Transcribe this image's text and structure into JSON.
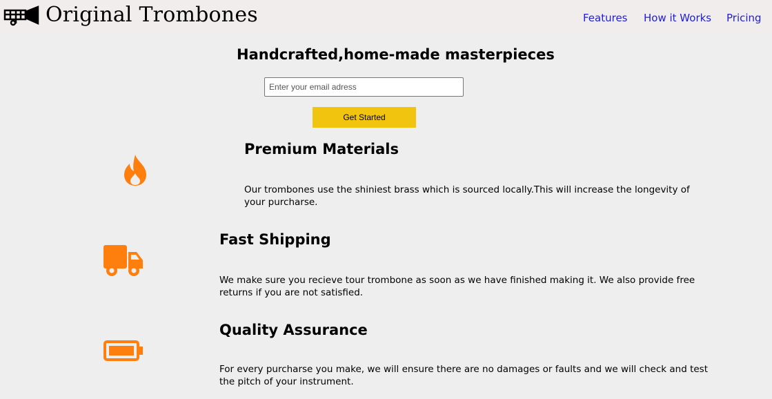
{
  "header": {
    "logo_text": "Original Trombones",
    "nav": [
      {
        "label": "Features"
      },
      {
        "label": "How it Works"
      },
      {
        "label": "Pricing"
      }
    ]
  },
  "hero": {
    "title": "Handcrafted,home-made masterpieces",
    "email_placeholder": "Enter your email adress",
    "email_value": "",
    "cta_label": "Get Started"
  },
  "features": [
    {
      "icon": "fire-icon",
      "title": "Premium Materials",
      "description": "Our trombones use the shiniest brass which is sourced locally.This will increase the longevity of your purcharse."
    },
    {
      "icon": "truck-icon",
      "title": "Fast Shipping",
      "description": "We make sure you recieve tour trombone as soon as we have finished making it. We also provide free returns if you are not satisfied."
    },
    {
      "icon": "battery-full-icon",
      "title": "Quality Assurance",
      "description": "For every purcharse you make, we will ensure there are no damages or faults and we will check and test the pitch of your instrument."
    }
  ],
  "colors": {
    "accent_orange": "#ff7f0e",
    "cta_yellow": "#f1c40f",
    "nav_link": "#1d1ddb",
    "header_bg": "#f2eded",
    "page_bg": "#eeeeee"
  }
}
